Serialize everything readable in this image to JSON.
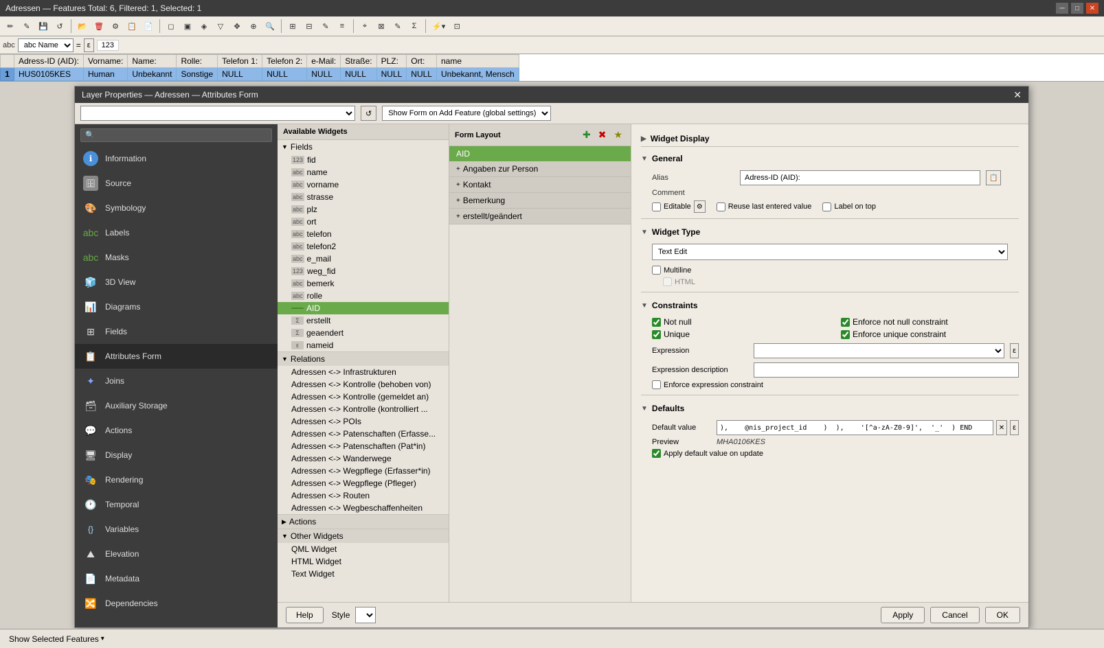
{
  "window": {
    "title": "Adressen — Features Total: 6, Filtered: 1, Selected: 1"
  },
  "toolbar": {
    "buttons": [
      "✏️",
      "📝",
      "💾",
      "🔄",
      "📂",
      "🗑",
      "⚙",
      "📋",
      "📄",
      "🔍",
      "📌",
      "✂",
      "🔗",
      "☑",
      "📊",
      "🔽",
      "⬆",
      "🔲",
      "🔍",
      "⚡",
      "📦"
    ]
  },
  "expr_bar": {
    "field_select": "abc Name",
    "operator": "=",
    "epsilon": "ε",
    "value": "123"
  },
  "table": {
    "columns": [
      "Adress-ID (AID):",
      "Vorname:",
      "Name:",
      "Rolle:",
      "Telefon 1:",
      "Telefon 2:",
      "e-Mail:",
      "Straße:",
      "PLZ:",
      "Ort:",
      "name"
    ],
    "rows": [
      {
        "num": "1",
        "cells": [
          "HUS0105KES",
          "Human",
          "Unbekannt",
          "Sonstige",
          "NULL",
          "NULL",
          "NULL",
          "NULL",
          "NULL",
          "NULL",
          "Unbekannt, Mensch"
        ]
      }
    ],
    "selected_row": 0
  },
  "dialog": {
    "title": "Layer Properties — Adressen — Attributes Form",
    "top_dropdown": "",
    "show_form_setting": "Show Form on Add Feature (global settings)",
    "sections": {
      "widget_display": "Widget Display",
      "general": "General",
      "widget_type": "Widget Type",
      "constraints": "Constraints",
      "defaults": "Defaults"
    },
    "general": {
      "alias_label": "Alias",
      "alias_value": "Adress-ID (AID):",
      "comment_label": "Comment",
      "editable_label": "Editable",
      "reuse_label": "Reuse last entered value",
      "label_on_top": "Label on top"
    },
    "widget_type": {
      "selected": "Text Edit",
      "multiline_label": "Multiline",
      "html_label": "HTML"
    },
    "constraints": {
      "not_null_label": "Not null",
      "not_null_checked": true,
      "enforce_not_null_label": "Enforce not null constraint",
      "enforce_not_null_checked": true,
      "unique_label": "Unique",
      "unique_checked": true,
      "enforce_unique_label": "Enforce unique constraint",
      "enforce_unique_checked": true,
      "expression_label": "Expression",
      "expression_desc_label": "Expression description",
      "enforce_expr_label": "Enforce expression constraint"
    },
    "defaults": {
      "label": "Defaults",
      "default_value_label": "Default value",
      "default_value_text": "),    @nis_project_id    )  ),    '[^a-zA-Z0-9]',  '_'  ) END",
      "preview_label": "Preview",
      "preview_value": "MHA0106KES",
      "apply_default_label": "Apply default value on update",
      "apply_default_checked": true
    }
  },
  "sidebar": {
    "items": [
      {
        "id": "information",
        "label": "Information",
        "icon": "ℹ"
      },
      {
        "id": "source",
        "label": "Source",
        "icon": "🗄"
      },
      {
        "id": "symbology",
        "label": "Symbology",
        "icon": "🎨"
      },
      {
        "id": "labels",
        "label": "Labels",
        "icon": "🔤"
      },
      {
        "id": "masks",
        "label": "Masks",
        "icon": "🔲"
      },
      {
        "id": "3d-view",
        "label": "3D View",
        "icon": "🧊"
      },
      {
        "id": "diagrams",
        "label": "Diagrams",
        "icon": "📊"
      },
      {
        "id": "fields",
        "label": "Fields",
        "icon": "⊞"
      },
      {
        "id": "attributes-form",
        "label": "Attributes Form",
        "icon": "📋",
        "active": true
      },
      {
        "id": "joins",
        "label": "Joins",
        "icon": "🔗"
      },
      {
        "id": "auxiliary-storage",
        "label": "Auxiliary Storage",
        "icon": "🗃"
      },
      {
        "id": "actions",
        "label": "Actions",
        "icon": "💬"
      },
      {
        "id": "display",
        "label": "Display",
        "icon": "🖥"
      },
      {
        "id": "rendering",
        "label": "Rendering",
        "icon": "🎭"
      },
      {
        "id": "temporal",
        "label": "Temporal",
        "icon": "🕐"
      },
      {
        "id": "variables",
        "label": "Variables",
        "icon": "{}"
      },
      {
        "id": "elevation",
        "label": "Elevation",
        "icon": "⛰"
      },
      {
        "id": "metadata",
        "label": "Metadata",
        "icon": "📄"
      },
      {
        "id": "dependencies",
        "label": "Dependencies",
        "icon": "🔀"
      }
    ]
  },
  "available_widgets": {
    "title": "Available Widgets",
    "fields_group": "Fields",
    "fields": [
      {
        "name": "fid",
        "type": "123"
      },
      {
        "name": "name",
        "type": "abc"
      },
      {
        "name": "vorname",
        "type": "abc"
      },
      {
        "name": "strasse",
        "type": "abc"
      },
      {
        "name": "plz",
        "type": "abc"
      },
      {
        "name": "ort",
        "type": "abc"
      },
      {
        "name": "telefon",
        "type": "abc"
      },
      {
        "name": "telefon2",
        "type": "abc"
      },
      {
        "name": "e_mail",
        "type": "abc"
      },
      {
        "name": "weg_fid",
        "type": "123"
      },
      {
        "name": "bemerk",
        "type": "abc"
      },
      {
        "name": "rolle",
        "type": "abc"
      },
      {
        "name": "AID",
        "type": "",
        "selected": true
      },
      {
        "name": "erstellt",
        "type": "Σ"
      },
      {
        "name": "geaendert",
        "type": "Σ"
      },
      {
        "name": "nameid",
        "type": "ε"
      }
    ],
    "relations_group": "Relations",
    "relations": [
      "Adressen <-> Infrastrukturen",
      "Adressen <-> Kontrolle (behoben von)",
      "Adressen <-> Kontrolle (gemeldet an)",
      "Adressen <-> Kontrolle (kontrolliert ...",
      "Adressen <-> POIs",
      "Adressen <-> Patenschaften (Erfasse...",
      "Adressen <-> Patenschaften (Pat*in)",
      "Adressen <-> Wanderwege",
      "Adressen <-> Wegpflege (Erfasser*in)",
      "Adressen <-> Wegpflege (Pfleger)",
      "Adressen <-> Routen",
      "Adressen <-> Wegbeschaffenheiten"
    ],
    "actions_group": "Actions",
    "other_widgets_group": "Other Widgets",
    "other_widgets": [
      "QML Widget",
      "HTML Widget",
      "Text Widget"
    ]
  },
  "form_layout": {
    "title": "Form Layout",
    "items": [
      {
        "name": "AID",
        "selected": true,
        "type": "field"
      },
      {
        "name": "Angaben zur Person",
        "type": "group",
        "expanded": true
      },
      {
        "name": "Kontakt",
        "type": "group",
        "expanded": true
      },
      {
        "name": "Bemerkung",
        "type": "group",
        "expanded": true
      },
      {
        "name": "erstellt/geändert",
        "type": "group",
        "expanded": true
      }
    ]
  },
  "footer": {
    "help_label": "Help",
    "style_label": "Style",
    "apply_label": "Apply",
    "cancel_label": "Cancel",
    "ok_label": "OK"
  },
  "status_bar": {
    "show_selected_label": "Show Selected Features",
    "show_selected_dropdown": "▾"
  }
}
